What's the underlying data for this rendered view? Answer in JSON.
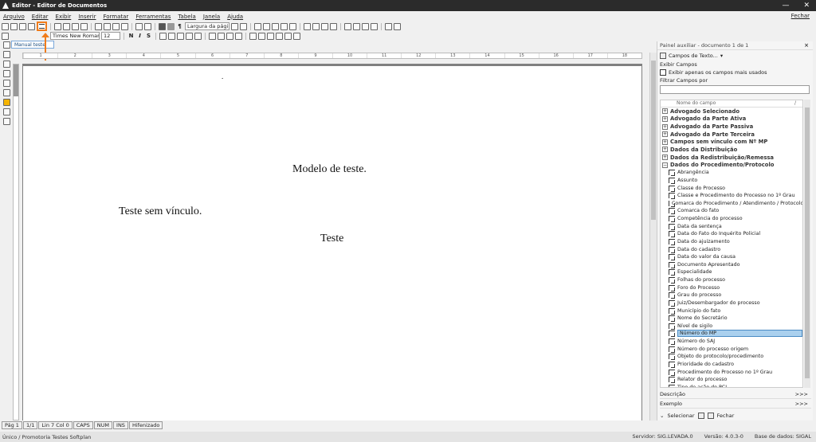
{
  "window": {
    "title": "Editor - Editor de Documentos",
    "minimize": "—",
    "close": "✕"
  },
  "menu": {
    "items": [
      "Arquivo",
      "Editar",
      "Exibir",
      "Inserir",
      "Formatar",
      "Ferramentas",
      "Tabela",
      "Janela",
      "Ajuda"
    ],
    "close_label": "Fechar"
  },
  "toolbar": {
    "zoom_value": "Largura da págin",
    "font_name": "Times New Roman",
    "font_size": "12",
    "bold": "N",
    "italic": "I",
    "strike": "S",
    "style_value": "Manual teste",
    "accent": "#f07c1b"
  },
  "ruler": {
    "ticks": [
      "1",
      "2",
      "3",
      "4",
      "5",
      "6",
      "7",
      "8",
      "9",
      "10",
      "11",
      "12",
      "13",
      "14",
      "15",
      "16",
      "17",
      "18"
    ]
  },
  "document": {
    "lines": [
      {
        "text": "Modelo de teste."
      },
      {
        "text": "Teste sem vínculo."
      },
      {
        "text": "Teste"
      }
    ],
    "dot": "."
  },
  "status": {
    "page": "Pág 1",
    "pages": "1/1",
    "position": "Lin 7  Col 0",
    "caps": "CAPS",
    "num": "NUM",
    "ins": "INS",
    "hyphen": "Hifenizado"
  },
  "footer": {
    "left": "Único / Promotoria Testes Softplan",
    "server": "Servidor: SIG.LEVADA.0",
    "version": "Versão: 4.0.3-0",
    "database": "Base de dados: SIGAL"
  },
  "panel": {
    "title": "Painel auxiliar - documento 1 de 1",
    "close": "×",
    "fields_combo": "Campos de Texto...",
    "show_fields": "Exibir Campos",
    "only_used": "Exibir apenas os campos mais usados",
    "filter_label": "Filtrar Campos por",
    "column_header": "Nome do campo",
    "column_sep": "/",
    "groups": [
      {
        "label": "Advogado Selecionado",
        "sign": "+"
      },
      {
        "label": "Advogado da Parte Ativa",
        "sign": "+"
      },
      {
        "label": "Advogado da Parte Passiva",
        "sign": "+"
      },
      {
        "label": "Advogado da Parte Terceira",
        "sign": "+"
      },
      {
        "label": "Campos sem vínculo com Nº MP",
        "sign": "+"
      },
      {
        "label": "Dados da Distribuição",
        "sign": "+"
      },
      {
        "label": "Dados da Redistribuição/Remessa",
        "sign": "+"
      },
      {
        "label": "Dados do Procedimento/Protocolo",
        "sign": "−"
      }
    ],
    "fields": [
      "Abrangência",
      "Assunto",
      "Classe do Processo",
      "Classe e Procedimento do Processo no 1º Grau",
      "Comarca do Procedimento / Atendimento / Protocolo",
      "Comarca do fato",
      "Competência do processo",
      "Data da sentença",
      "Data do Fato do Inquérito Policial",
      "Data do ajuizamento",
      "Data do cadastro",
      "Data do valor da causa",
      "Documento Apresentado",
      "Especialidade",
      "Folhas do processo",
      "Foro do Processo",
      "Grau do processo",
      "Juiz/Desembargador do processo",
      "Município do fato",
      "Nome do Secretário",
      "Nível de sigilo",
      "Número do MP",
      "Número do SAJ",
      "Número do processo origem",
      "Objeto do protocolo/procedimento",
      "Prioridade do cadastro",
      "Procedimento do Processo no 1º Grau",
      "Relator do processo",
      "Tipo de ação do PCJ"
    ],
    "selected_field": "Número do MP",
    "description": "Descrição",
    "example": "Exemplo",
    "more": ">>>",
    "select_label": "Selecionar",
    "close_label": "Fechar"
  }
}
